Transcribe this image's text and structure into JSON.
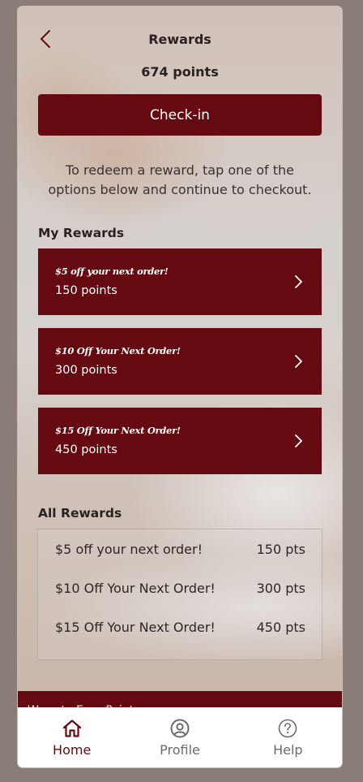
{
  "header": {
    "title": "Rewards",
    "points_total": "674 points"
  },
  "checkin": {
    "label": "Check-in"
  },
  "instructions": "To redeem a reward, tap one of the options below and continue to checkout.",
  "my_rewards": {
    "title": "My Rewards",
    "items": [
      {
        "name": "$5 off your next order!",
        "points": "150 points"
      },
      {
        "name": "$10 Off Your Next Order!",
        "points": "300 points"
      },
      {
        "name": "$15 Off Your Next Order!",
        "points": "450 points"
      }
    ]
  },
  "all_rewards": {
    "title": "All Rewards",
    "items": [
      {
        "name": "$5 off your next order!",
        "points": "150 pts"
      },
      {
        "name": "$10 Off Your Next Order!",
        "points": "300 pts"
      },
      {
        "name": "$15 Off Your Next Order!",
        "points": "450 pts"
      }
    ]
  },
  "ways_banner": {
    "label": "Ways to Earn Points"
  },
  "tabs": [
    {
      "label": "Home",
      "icon": "home-icon",
      "active": true
    },
    {
      "label": "Profile",
      "icon": "profile-icon",
      "active": false
    },
    {
      "label": "Help",
      "icon": "help-icon",
      "active": false
    }
  ],
  "colors": {
    "brand": "#650a10",
    "text": "#2a2222",
    "tab_inactive": "#6b6b6b"
  }
}
